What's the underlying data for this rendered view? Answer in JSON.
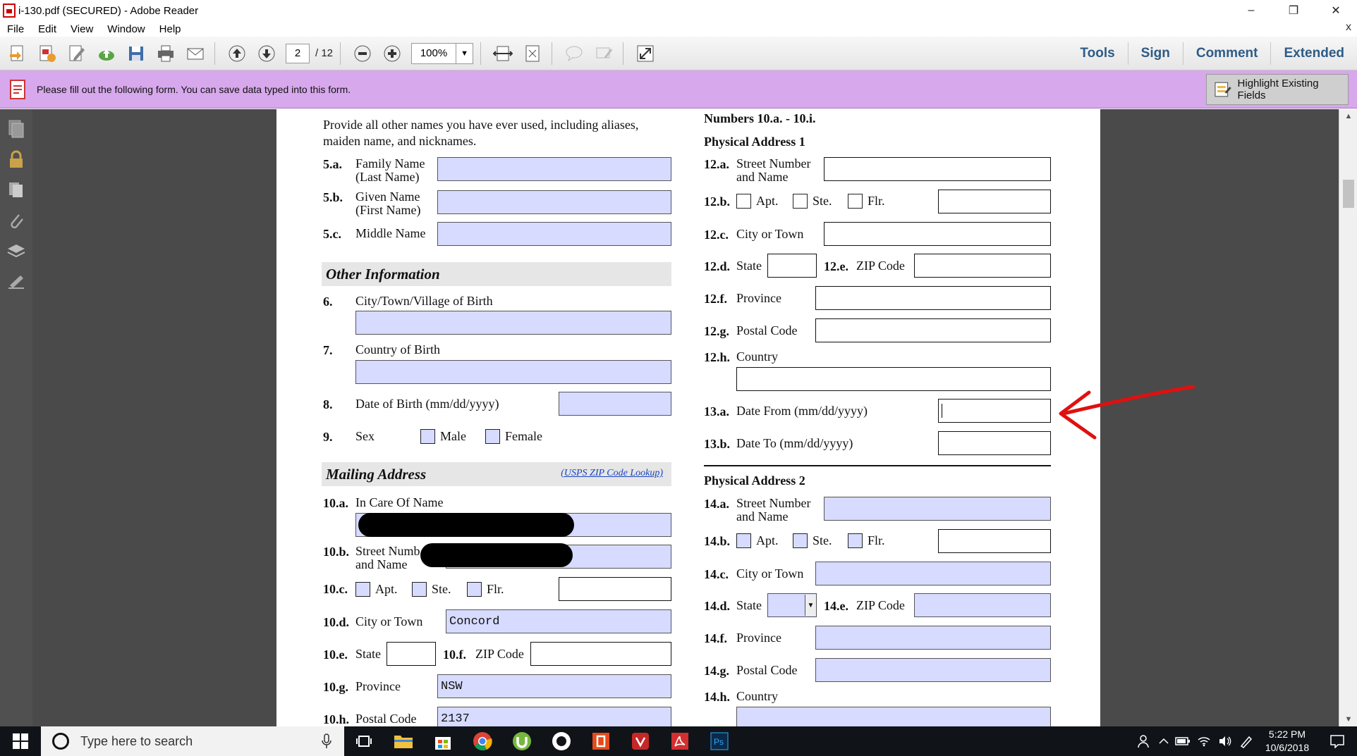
{
  "window": {
    "title": "i-130.pdf (SECURED) - Adobe Reader",
    "minimize": "–",
    "restore": "❐",
    "close": "✕"
  },
  "menu": {
    "items": [
      "File",
      "Edit",
      "View",
      "Window",
      "Help"
    ],
    "close": "x"
  },
  "toolbar": {
    "page_current": "2",
    "page_total": "/ 12",
    "zoom": "100%",
    "right": [
      "Tools",
      "Sign",
      "Comment",
      "Extended"
    ]
  },
  "formbar": {
    "message": "Please fill out the following form. You can save data typed into this form.",
    "highlight_label": "Highlight Existing Fields"
  },
  "form": {
    "left": {
      "intro": [
        "Provide all other names you have ever used, including aliases,",
        "maiden name, and nicknames."
      ],
      "q5a": {
        "num": "5.a.",
        "label": [
          "Family Name",
          "(Last Name)"
        ]
      },
      "q5b": {
        "num": "5.b.",
        "label": [
          "Given Name",
          "(First Name)"
        ]
      },
      "q5c": {
        "num": "5.c.",
        "label": "Middle Name"
      },
      "other_info": "Other Information",
      "q6": {
        "num": "6.",
        "label": "City/Town/Village of Birth"
      },
      "q7": {
        "num": "7.",
        "label": "Country of Birth"
      },
      "q8": {
        "num": "8.",
        "label": "Date of Birth (mm/dd/yyyy)"
      },
      "q9": {
        "num": "9.",
        "label": "Sex",
        "male": "Male",
        "female": "Female"
      },
      "mailing": "Mailing Address",
      "usps_link": "(USPS ZIP Code Lookup)",
      "q10a": {
        "num": "10.a.",
        "label": "In Care Of Name"
      },
      "q10b": {
        "num": "10.b.",
        "label": [
          "Street Numb",
          "and Name"
        ]
      },
      "q10c": {
        "num": "10.c.",
        "apt": "Apt.",
        "ste": "Ste.",
        "flr": "Flr."
      },
      "q10d": {
        "num": "10.d.",
        "label": "City or Town",
        "value": "Concord"
      },
      "q10e": {
        "num": "10.e.",
        "label": "State"
      },
      "q10f": {
        "num": "10.f.",
        "label": "ZIP Code"
      },
      "q10g": {
        "num": "10.g.",
        "label": "Province",
        "value": "NSW"
      },
      "q10h": {
        "num": "10.h.",
        "label": "Postal Code",
        "value": "2137"
      }
    },
    "right": {
      "top_line": "Numbers 10.a. - 10.i.",
      "phys1": "Physical Address 1",
      "q12a": {
        "num": "12.a.",
        "label": [
          "Street Number",
          "and Name"
        ]
      },
      "q12b": {
        "num": "12.b.",
        "apt": "Apt.",
        "ste": "Ste.",
        "flr": "Flr."
      },
      "q12c": {
        "num": "12.c.",
        "label": "City or Town"
      },
      "q12d": {
        "num": "12.d.",
        "label": "State"
      },
      "q12e": {
        "num": "12.e.",
        "label": "ZIP Code"
      },
      "q12f": {
        "num": "12.f.",
        "label": "Province"
      },
      "q12g": {
        "num": "12.g.",
        "label": "Postal Code"
      },
      "q12h": {
        "num": "12.h.",
        "label": "Country"
      },
      "q13a": {
        "num": "13.a.",
        "label": "Date From (mm/dd/yyyy)"
      },
      "q13b": {
        "num": "13.b.",
        "label": "Date To (mm/dd/yyyy)"
      },
      "phys2": "Physical Address 2",
      "q14a": {
        "num": "14.a.",
        "label": [
          "Street Number",
          "and Name"
        ]
      },
      "q14b": {
        "num": "14.b.",
        "apt": "Apt.",
        "ste": "Ste.",
        "flr": "Flr."
      },
      "q14c": {
        "num": "14.c.",
        "label": "City or Town"
      },
      "q14d": {
        "num": "14.d.",
        "label": "State"
      },
      "q14e": {
        "num": "14.e.",
        "label": "ZIP Code"
      },
      "q14f": {
        "num": "14.f.",
        "label": "Province"
      },
      "q14g": {
        "num": "14.g.",
        "label": "Postal Code"
      },
      "q14h": {
        "num": "14.h.",
        "label": "Country"
      }
    }
  },
  "taskbar": {
    "search_placeholder": "Type here to search",
    "time": "5:22 PM",
    "date": "10/6/2018"
  },
  "colors": {
    "form_bar": "#d7a8ec",
    "field_highlight": "#d6dbff",
    "annotation_arrow": "#e01010",
    "tools_text": "#2e5b86"
  }
}
